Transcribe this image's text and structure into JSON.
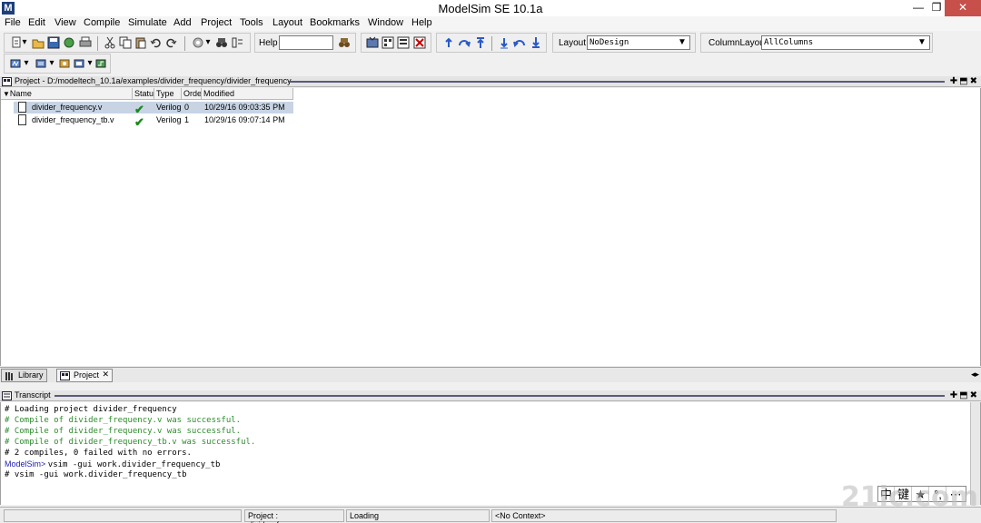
{
  "window": {
    "title": "ModelSim SE 10.1a",
    "app_icon_letter": "M",
    "minimize": "—",
    "restore": "❐",
    "close": "✕"
  },
  "menu": [
    "File",
    "Edit",
    "View",
    "Compile",
    "Simulate",
    "Add",
    "Project",
    "Tools",
    "Layout",
    "Bookmarks",
    "Window",
    "Help"
  ],
  "toolbar": {
    "help_label": "Help",
    "help_value": "",
    "layout_label": "Layout",
    "layout_value": "NoDesign",
    "column_layout_label": "ColumnLayout",
    "column_layout_value": "AllColumns"
  },
  "project_panel": {
    "title": "Project - D:/modeltech_10.1a/examples/divider_frequency/divider_frequency",
    "columns": [
      "Name",
      "Status",
      "Type",
      "Order",
      "Modified"
    ],
    "rows": [
      {
        "name": "divider_frequency.v",
        "status": "✔",
        "type": "Verilog",
        "order": "0",
        "modified": "10/29/16 09:03:35 PM",
        "selected": true
      },
      {
        "name": "divider_frequency_tb.v",
        "status": "✔",
        "type": "Verilog",
        "order": "1",
        "modified": "10/29/16 09:07:14 PM",
        "selected": false
      }
    ],
    "status_color": "#1a8a1a"
  },
  "tabs": [
    {
      "label": "Library",
      "active": false
    },
    {
      "label": "Project",
      "active": true
    }
  ],
  "transcript": {
    "title": "Transcript",
    "lines": [
      {
        "text": "# Loading project divider_frequency",
        "kind": "normal"
      },
      {
        "text": "# Compile of divider_frequency.v was successful.",
        "kind": "green"
      },
      {
        "text": "# Compile of divider_frequency.v was successful.",
        "kind": "green"
      },
      {
        "text": "# Compile of divider_frequency_tb.v was successful.",
        "kind": "green"
      },
      {
        "text": "# 2 compiles, 0 failed with no errors.",
        "kind": "normal"
      },
      {
        "text": "vsim -gui work.divider_frequency_tb",
        "kind": "prompt",
        "prompt": "ModelSim> "
      },
      {
        "text": "# vsim -gui work.divider_frequency_tb",
        "kind": "normal"
      }
    ]
  },
  "statusbar": {
    "project": "Project : divider_frequency",
    "state": "Loading",
    "context": "<No Context>"
  },
  "ime": [
    "中",
    "键",
    "★",
    "°,",
    "⋯"
  ],
  "watermark": "21ic.com"
}
